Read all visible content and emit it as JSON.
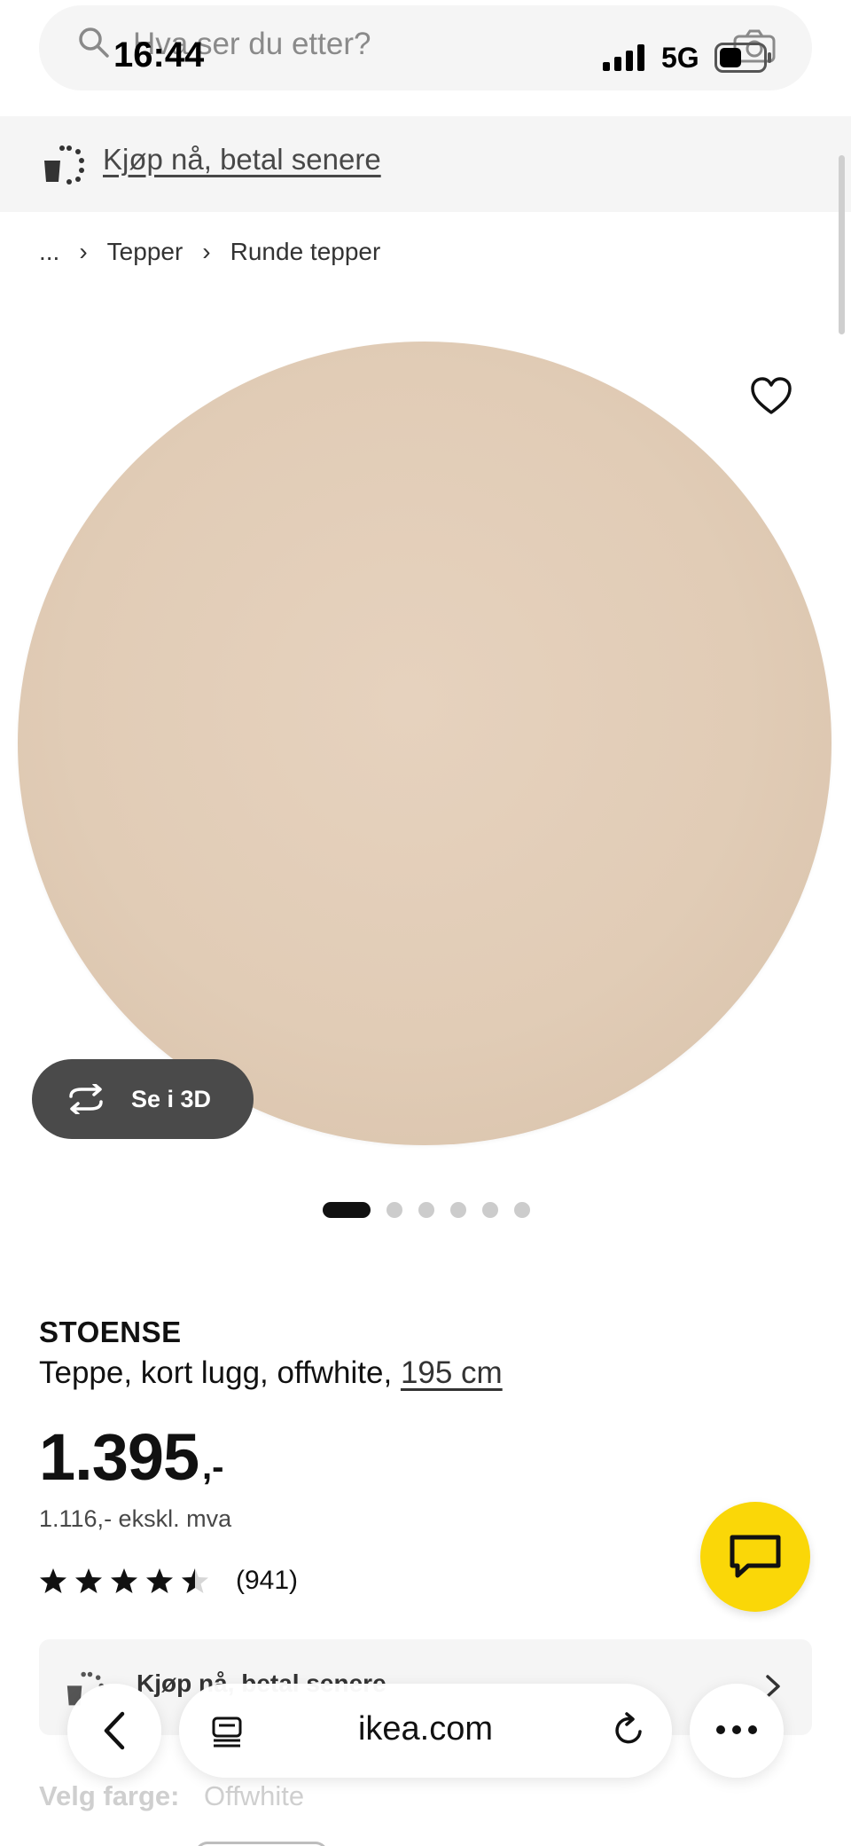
{
  "status_bar": {
    "time": "16:44",
    "network": "5G"
  },
  "search": {
    "placeholder": "Hva ser du etter?"
  },
  "promo": {
    "link_text": "Kjøp nå, betal senere"
  },
  "breadcrumb": {
    "ellipsis": "...",
    "items": [
      "Tepper",
      "Runde tepper"
    ]
  },
  "product": {
    "name": "STOENSE",
    "description": "Teppe, kort lugg, offwhite, ",
    "size_link": "195 cm",
    "price": "1.395",
    "price_suffix": ",-",
    "price_ex_vat": "1.116,- ekskl. mva",
    "rating": 4.5,
    "review_count": "(941)",
    "view_3d_label": "Se i 3D",
    "image_count": 6,
    "active_image": 1
  },
  "financing": {
    "label": "Kjøp nå, betal senere"
  },
  "color": {
    "label": "Velg farge:",
    "value": "Offwhite"
  },
  "browser": {
    "address": "ikea.com"
  },
  "colors": {
    "accent_yellow": "#fad708",
    "rug": "#e1ccb6",
    "dark_button": "#4a4a4a"
  },
  "icons": [
    "search-icon",
    "camera-icon",
    "heart-icon",
    "rotate-3d-icon",
    "chat-icon",
    "star-icon",
    "chevron-right-icon",
    "back-icon",
    "reader-icon",
    "reload-icon",
    "more-icon"
  ]
}
